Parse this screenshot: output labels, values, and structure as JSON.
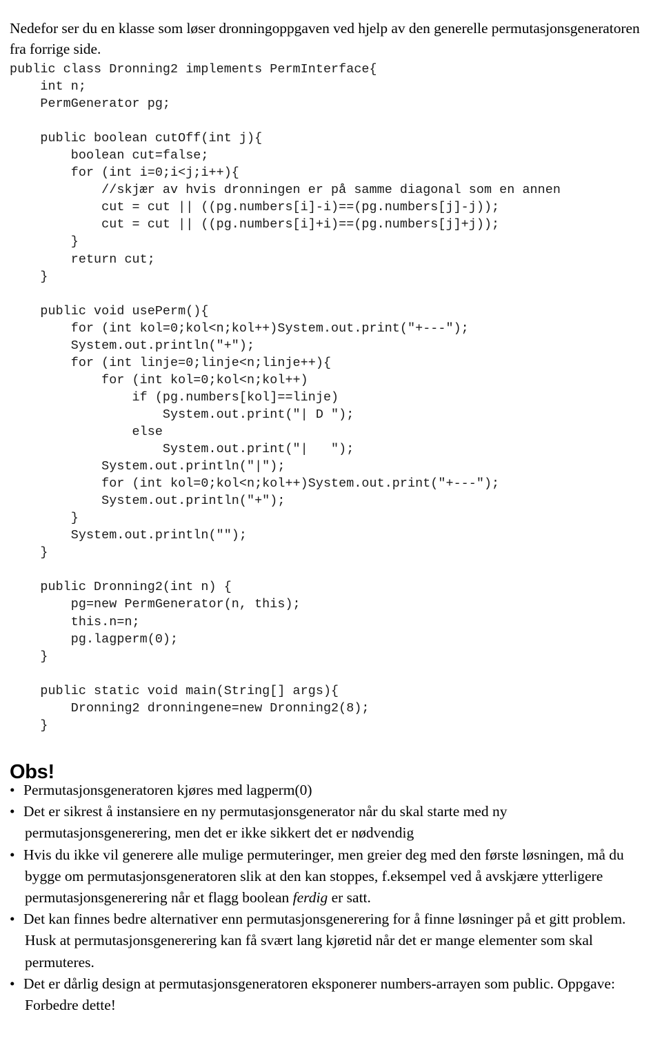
{
  "document": {
    "intro_paragraph": "Nedefor ser du en klasse som løser dronningoppgaven ved hjelp av den generelle permutasjonsgeneratoren fra forrige side.",
    "code_language": "java",
    "code_lines": [
      "public class Dronning2 implements PermInterface{",
      "    int n;",
      "    PermGenerator pg;",
      "",
      "    public boolean cutOff(int j){",
      "        boolean cut=false;",
      "        for (int i=0;i<j;i++){",
      "            //skjær av hvis dronningen er på samme diagonal som en annen",
      "            cut = cut || ((pg.numbers[i]-i)==(pg.numbers[j]-j));",
      "            cut = cut || ((pg.numbers[i]+i)==(pg.numbers[j]+j));",
      "        }",
      "        return cut;",
      "    }",
      "",
      "    public void usePerm(){",
      "        for (int kol=0;kol<n;kol++)System.out.print(\"+---\");",
      "        System.out.println(\"+\");",
      "        for (int linje=0;linje<n;linje++){",
      "            for (int kol=0;kol<n;kol++)",
      "                if (pg.numbers[kol]==linje)",
      "                    System.out.print(\"| D \");",
      "                else",
      "                    System.out.print(\"|   \");",
      "            System.out.println(\"|\");",
      "            for (int kol=0;kol<n;kol++)System.out.print(\"+---\");",
      "            System.out.println(\"+\");",
      "        }",
      "        System.out.println(\"\");",
      "    }",
      "",
      "    public Dronning2(int n) {",
      "        pg=new PermGenerator(n, this);",
      "        this.n=n;",
      "        pg.lagperm(0);",
      "    }",
      "",
      "    public static void main(String[] args){",
      "        Dronning2 dronningene=new Dronning2(8);",
      "    }"
    ],
    "obs_heading": "Obs!",
    "bullet_symbol": "•",
    "notes": [
      {
        "id": "note-lagperm",
        "html": "Permutasjonsgeneratoren kjøres med lagperm(0)"
      },
      {
        "id": "note-instansiere",
        "html": "Det er sikrest å instansiere en ny permutasjonsgenerator når du skal starte med ny permutasjonsgenerering, men det er ikke sikkert det er nødvendig"
      },
      {
        "id": "note-stoppe",
        "html": "Hvis du ikke vil generere alle mulige permuteringer, men greier deg med den første løsningen, må du bygge om permutasjonsgeneratoren slik at den kan stoppes, f.eksempel ved å avskjære ytterligere permutasjonsgenerering når et flagg boolean <em>ferdig</em> er satt."
      },
      {
        "id": "note-alternativer",
        "html": "Det kan finnes bedre alternativer enn permutasjonsgenerering for å finne løsninger på et gitt problem. Husk at permutasjonsgenerering kan få svært lang kjøretid når det er mange elementer som skal permuteres."
      },
      {
        "id": "note-design",
        "html": "Det er dårlig design at permutasjonsgeneratoren eksponerer numbers-arrayen som public. Oppgave: Forbedre dette!"
      }
    ],
    "colors": {
      "page_background": "#ffffff",
      "body_text": "#000000",
      "code_text": "#1a1a1a"
    }
  }
}
